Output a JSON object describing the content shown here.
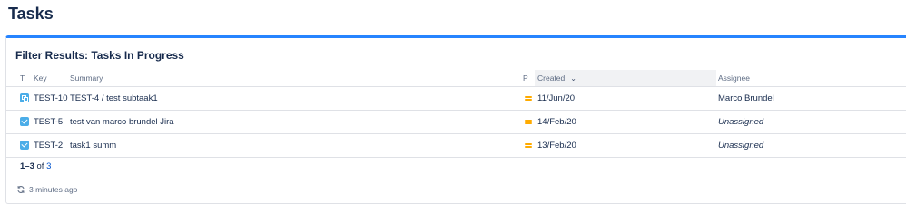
{
  "page": {
    "title": "Tasks"
  },
  "gadget": {
    "title": "Filter Results: Tasks In Progress",
    "accent_color": "#2684ff",
    "columns": {
      "type": "T",
      "key": "Key",
      "summary": "Summary",
      "priority": "P",
      "created": "Created",
      "assignee": "Assignee"
    },
    "sort": {
      "column": "Created",
      "icon": "chevron-down-icon"
    },
    "rows": [
      {
        "type_icon": "subtask-icon",
        "key": "TEST-10",
        "summary": "TEST-4 / test subtaak1",
        "priority_icon": "priority-medium-icon",
        "created": "11/Jun/20",
        "assignee": "Marco Brundel",
        "assignee_unassigned": false
      },
      {
        "type_icon": "task-icon",
        "key": "TEST-5",
        "summary": "test van marco brundel Jira",
        "priority_icon": "priority-medium-icon",
        "created": "14/Feb/20",
        "assignee": "Unassigned",
        "assignee_unassigned": true
      },
      {
        "type_icon": "task-icon",
        "key": "TEST-2",
        "summary": "task1 summ",
        "priority_icon": "priority-medium-icon",
        "created": "13/Feb/20",
        "assignee": "Unassigned",
        "assignee_unassigned": true
      }
    ],
    "pagination": {
      "range": "1–3",
      "of_label": "of",
      "total": "3"
    },
    "footer": {
      "refresh_icon": "refresh-icon",
      "updated": "3 minutes ago"
    }
  }
}
